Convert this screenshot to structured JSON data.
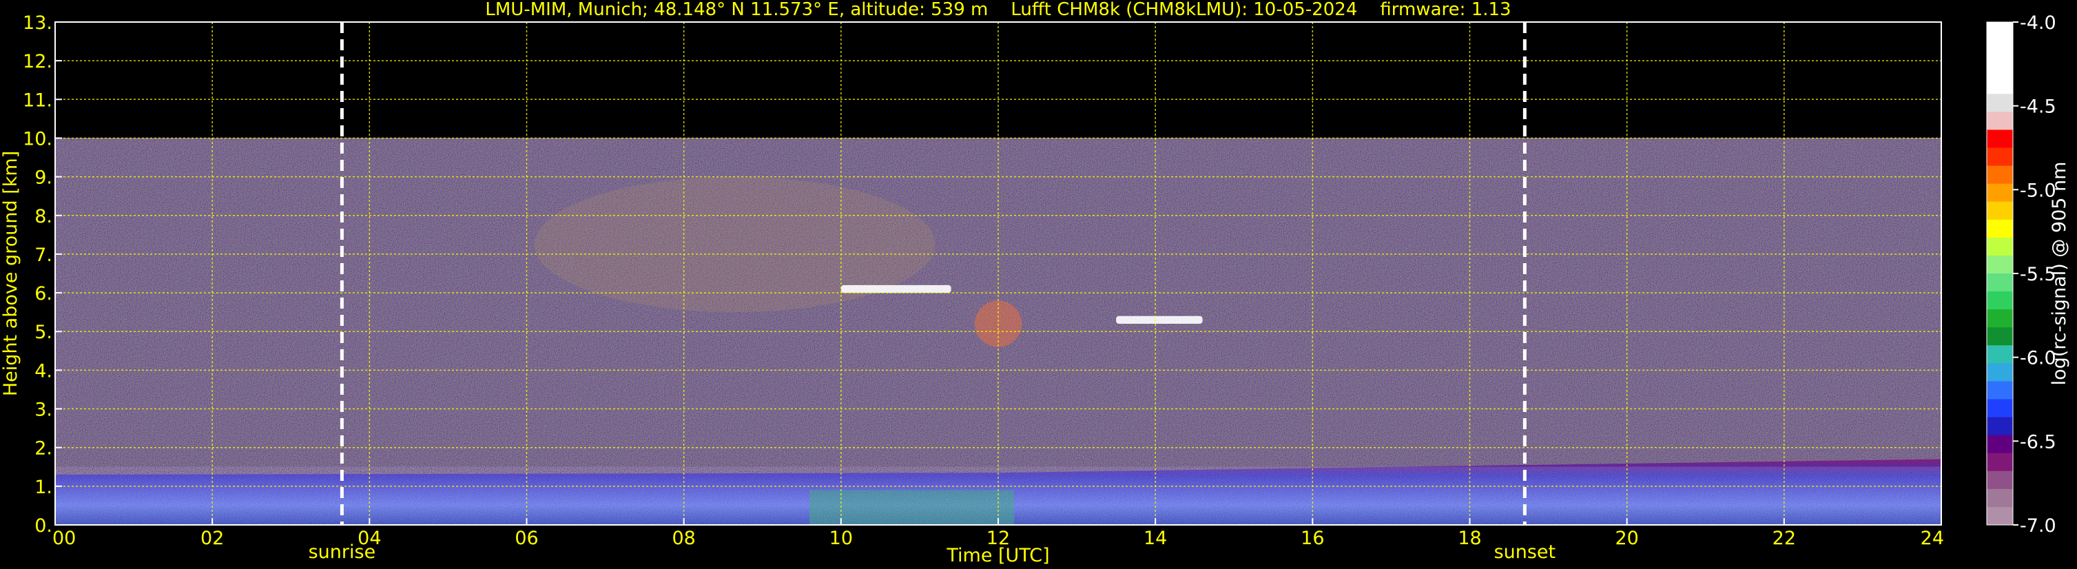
{
  "chart_data": {
    "type": "heatmap",
    "title": "LMU-MIM, Munich; 48.148° N 11.573° E, altitude: 539 m    Lufft CHM8k (CHM8kLMU): 10-05-2024    firmware: 1.13",
    "xlabel": "Time [UTC]",
    "ylabel": "Height above ground [km]",
    "xlim": [
      0,
      24
    ],
    "ylim": [
      0,
      13
    ],
    "x_ticks": [
      "00",
      "02",
      "04",
      "06",
      "08",
      "10",
      "12",
      "14",
      "16",
      "18",
      "20",
      "22",
      "24"
    ],
    "x_tick_values": [
      0,
      2,
      4,
      6,
      8,
      10,
      12,
      14,
      16,
      18,
      20,
      22,
      24
    ],
    "y_ticks": [
      "0.",
      "1.",
      "2.",
      "3.",
      "4.",
      "5.",
      "6.",
      "7.",
      "8.",
      "9.",
      "10.",
      "11.",
      "12.",
      "13."
    ],
    "y_tick_values": [
      0,
      1,
      2,
      3,
      4,
      5,
      6,
      7,
      8,
      9,
      10,
      11,
      12,
      13
    ],
    "grid": true,
    "data_ceiling_km": 10,
    "annotations": [
      {
        "label": "sunrise",
        "x": 3.65
      },
      {
        "label": "sunset",
        "x": 18.7
      }
    ],
    "colorbar": {
      "label": "log(rc-signal) @ 905 nm",
      "ticks": [
        "-4.0",
        "-4.5",
        "-5.0",
        "-5.5",
        "-6.0",
        "-6.5",
        "-7.0"
      ],
      "tick_values": [
        -4.0,
        -4.5,
        -5.0,
        -5.5,
        -6.0,
        -6.5,
        -7.0
      ],
      "range": [
        -7.0,
        -4.0
      ],
      "colors": [
        "#b090a8",
        "#a07898",
        "#905088",
        "#801878",
        "#600080",
        "#2020c0",
        "#2040ff",
        "#3070ff",
        "#30a8e0",
        "#30c0b0",
        "#109030",
        "#20b030",
        "#30d060",
        "#60e080",
        "#90f080",
        "#c0ff40",
        "#ffff00",
        "#ffd000",
        "#ffa000",
        "#ff7000",
        "#ff3000",
        "#ff0000",
        "#f0c0c0",
        "#e0e0e0",
        "#ffffff",
        "#ffffff",
        "#ffffff",
        "#ffffff"
      ]
    },
    "features": [
      {
        "name": "boundary-layer",
        "x": [
          0,
          24
        ],
        "top_km": [
          1.3,
          1.7
        ]
      },
      {
        "name": "cirrus",
        "x": [
          6.1,
          11.2
        ],
        "height_km": [
          5.5,
          9.0
        ]
      },
      {
        "name": "cloud-layer",
        "x": [
          10.0,
          11.4
        ],
        "height_km": [
          6.0,
          6.2
        ]
      },
      {
        "name": "cloud-layer",
        "x": [
          13.5,
          14.6
        ],
        "height_km": [
          5.2,
          5.4
        ]
      },
      {
        "name": "mid-cloud",
        "x": [
          11.7,
          12.3
        ],
        "height_km": [
          4.6,
          5.8
        ]
      }
    ]
  }
}
